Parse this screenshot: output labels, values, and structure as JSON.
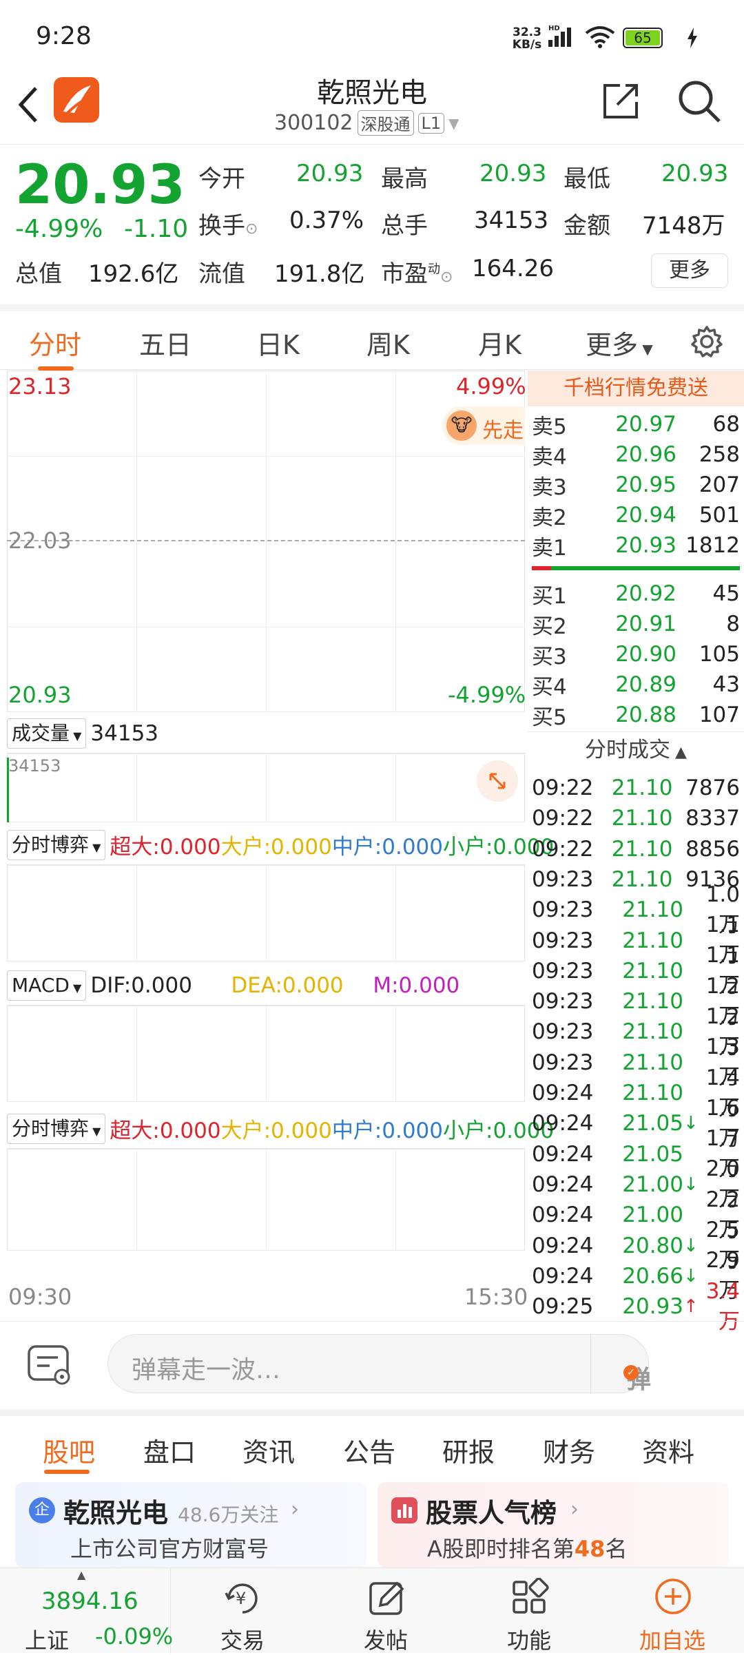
{
  "status": {
    "time": "9:28",
    "speed": "32.3",
    "speed_unit": "KB/s",
    "battery": "65"
  },
  "header": {
    "title": "乾照光电",
    "code": "300102",
    "tag1": "深股通",
    "tag2": "L1"
  },
  "quote": {
    "price": "20.93",
    "pct": "-4.99%",
    "change": "-1.10",
    "open_label": "今开",
    "open": "20.93",
    "high_label": "最高",
    "high": "20.93",
    "low_label": "最低",
    "low": "20.93",
    "turnover_label": "换手",
    "turnover": "0.37%",
    "volume_label": "总手",
    "volume": "34153",
    "amount_label": "金额",
    "amount": "7148万",
    "mktcap_label": "总值",
    "mktcap": "192.6亿",
    "float_label": "流值",
    "float": "191.8亿",
    "pe_label": "市盈",
    "pe_sup": "动",
    "pe": "164.26",
    "more": "更多"
  },
  "tabs": [
    "分时",
    "五日",
    "日K",
    "周K",
    "月K",
    "更多"
  ],
  "chart": {
    "top_price": "23.13",
    "top_pct": "4.99%",
    "mid_price": "22.03",
    "bottom_price": "20.93",
    "bottom_pct": "-4.99%",
    "promo": "先走",
    "volume_selector": "成交量",
    "volume_value": "34153",
    "volume_axis": "34153",
    "game_selector": "分时博弈",
    "super_large": "超大:0.000",
    "large": "大户:0.000",
    "medium": "中户:0.000",
    "small": "小户:0.000",
    "macd_selector": "MACD",
    "dif": "DIF:0.000",
    "dea": "DEA:0.000",
    "m": "M:0.000",
    "time_start": "09:30",
    "time_end": "15:30",
    "colors": {
      "down": "#13a330",
      "up": "#e0232a",
      "accent": "#f16a1d"
    }
  },
  "book": {
    "banner": "千档行情免费送",
    "asks": [
      {
        "label": "卖5",
        "price": "20.97",
        "vol": "68"
      },
      {
        "label": "卖4",
        "price": "20.96",
        "vol": "258"
      },
      {
        "label": "卖3",
        "price": "20.95",
        "vol": "207"
      },
      {
        "label": "卖2",
        "price": "20.94",
        "vol": "501"
      },
      {
        "label": "卖1",
        "price": "20.93",
        "vol": "1812"
      }
    ],
    "bids": [
      {
        "label": "买1",
        "price": "20.92",
        "vol": "45"
      },
      {
        "label": "买2",
        "price": "20.91",
        "vol": "8"
      },
      {
        "label": "买3",
        "price": "20.90",
        "vol": "105"
      },
      {
        "label": "买4",
        "price": "20.89",
        "vol": "43"
      },
      {
        "label": "买5",
        "price": "20.88",
        "vol": "107"
      }
    ],
    "trades_title": "分时成交",
    "trades": [
      {
        "t": "09:22",
        "p": "21.10",
        "a": "",
        "v": "7876"
      },
      {
        "t": "09:22",
        "p": "21.10",
        "a": "",
        "v": "8337"
      },
      {
        "t": "09:22",
        "p": "21.10",
        "a": "",
        "v": "8856"
      },
      {
        "t": "09:23",
        "p": "21.10",
        "a": "",
        "v": "9136"
      },
      {
        "t": "09:23",
        "p": "21.10",
        "a": "",
        "v": "1.0万"
      },
      {
        "t": "09:23",
        "p": "21.10",
        "a": "",
        "v": "1.1万"
      },
      {
        "t": "09:23",
        "p": "21.10",
        "a": "",
        "v": "1.1万"
      },
      {
        "t": "09:23",
        "p": "21.10",
        "a": "",
        "v": "1.2万"
      },
      {
        "t": "09:23",
        "p": "21.10",
        "a": "",
        "v": "1.2万"
      },
      {
        "t": "09:23",
        "p": "21.10",
        "a": "",
        "v": "1.3万"
      },
      {
        "t": "09:24",
        "p": "21.10",
        "a": "",
        "v": "1.4万"
      },
      {
        "t": "09:24",
        "p": "21.05",
        "a": "↓",
        "v": "1.6万"
      },
      {
        "t": "09:24",
        "p": "21.05",
        "a": "",
        "v": "1.7万"
      },
      {
        "t": "09:24",
        "p": "21.00",
        "a": "↓",
        "v": "2.0万"
      },
      {
        "t": "09:24",
        "p": "21.00",
        "a": "",
        "v": "2.2万"
      },
      {
        "t": "09:24",
        "p": "20.80",
        "a": "↓",
        "v": "2.5万"
      },
      {
        "t": "09:24",
        "p": "20.66",
        "a": "↓",
        "v": "2.9万"
      },
      {
        "t": "09:25",
        "p": "20.93",
        "a": "↑",
        "v": "3.4万"
      }
    ]
  },
  "comment": {
    "placeholder": "弹幕走一波…",
    "danmu": "弹"
  },
  "bottom_tabs": [
    "股吧",
    "盘口",
    "资讯",
    "公告",
    "研报",
    "财务",
    "资料"
  ],
  "cards": {
    "left_title": "乾照光电",
    "left_follow": "48.6万关注",
    "left_sub": "上市公司官方财富号",
    "right_title": "股票人气榜",
    "right_sub_pre": "A股即时排名第",
    "right_rank": "48",
    "right_sub_post": "名"
  },
  "nav": {
    "index_value": "3894.16",
    "index_name": "上证",
    "index_pct": "-0.09%",
    "trade": "交易",
    "post": "发帖",
    "func": "功能",
    "add": "加自选"
  }
}
